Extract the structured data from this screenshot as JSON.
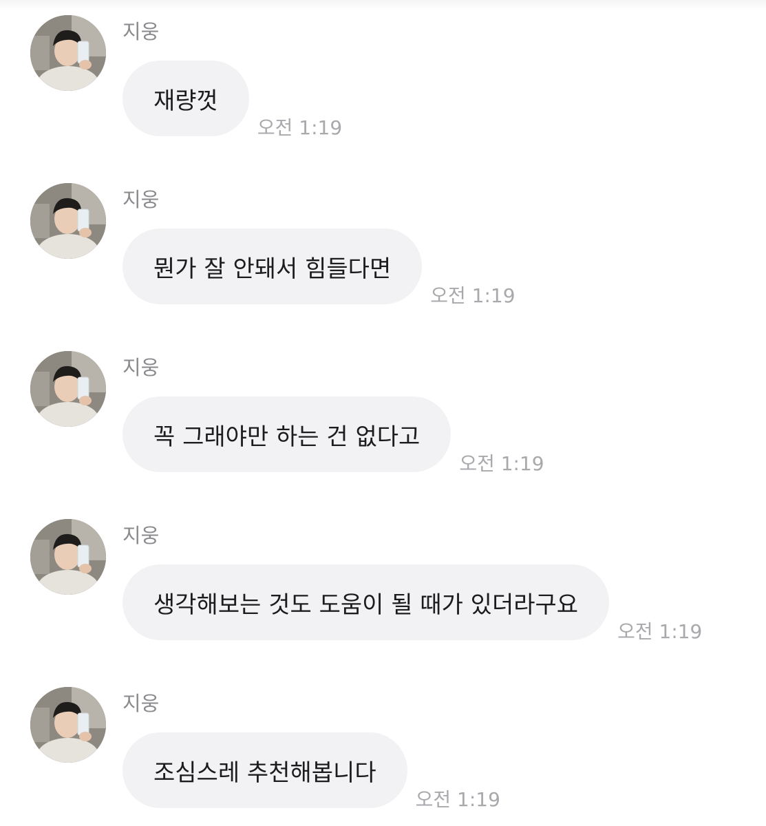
{
  "messages": [
    {
      "sender": "지웅",
      "text": "재량껏",
      "time": "오전 1:19"
    },
    {
      "sender": "지웅",
      "text": "뭔가 잘 안돼서 힘들다면",
      "time": "오전 1:19"
    },
    {
      "sender": "지웅",
      "text": "꼭 그래야만 하는 건 없다고",
      "time": "오전 1:19"
    },
    {
      "sender": "지웅",
      "text": "생각해보는 것도 도움이 될 때가 있더라구요",
      "time": "오전 1:19"
    },
    {
      "sender": "지웅",
      "text": "조심스레 추천해봅니다",
      "time": "오전 1:19"
    }
  ],
  "colors": {
    "bubble": "#f2f2f5",
    "timestamp": "#a8a8ad",
    "sender": "#8a8a8e"
  }
}
